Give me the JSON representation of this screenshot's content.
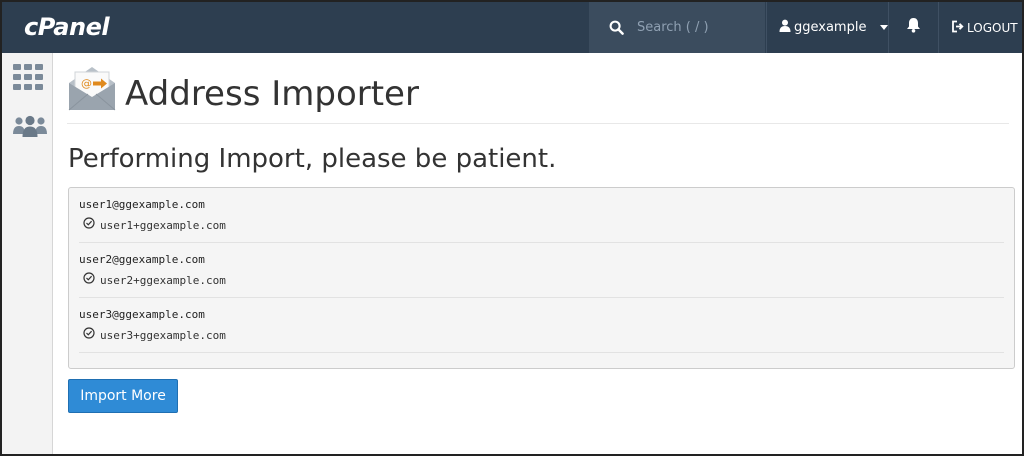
{
  "header": {
    "logo": "cPanel",
    "search_placeholder": "Search ( / )",
    "username": "ggexample",
    "logout_label": "LOGOUT"
  },
  "colors": {
    "topbar": "#2d3e50",
    "accent_button": "#2f8bd6"
  },
  "sidebar": {
    "items": [
      {
        "icon": "grid-icon"
      },
      {
        "icon": "users-icon"
      }
    ]
  },
  "main": {
    "title": "Address Importer",
    "subheading": "Performing Import, please be patient.",
    "results": [
      {
        "email": "user1@ggexample.com",
        "alias": "user1+ggexample.com"
      },
      {
        "email": "user2@ggexample.com",
        "alias": "user2+ggexample.com"
      },
      {
        "email": "user3@ggexample.com",
        "alias": "user3+ggexample.com"
      }
    ],
    "import_more_label": "Import More"
  }
}
